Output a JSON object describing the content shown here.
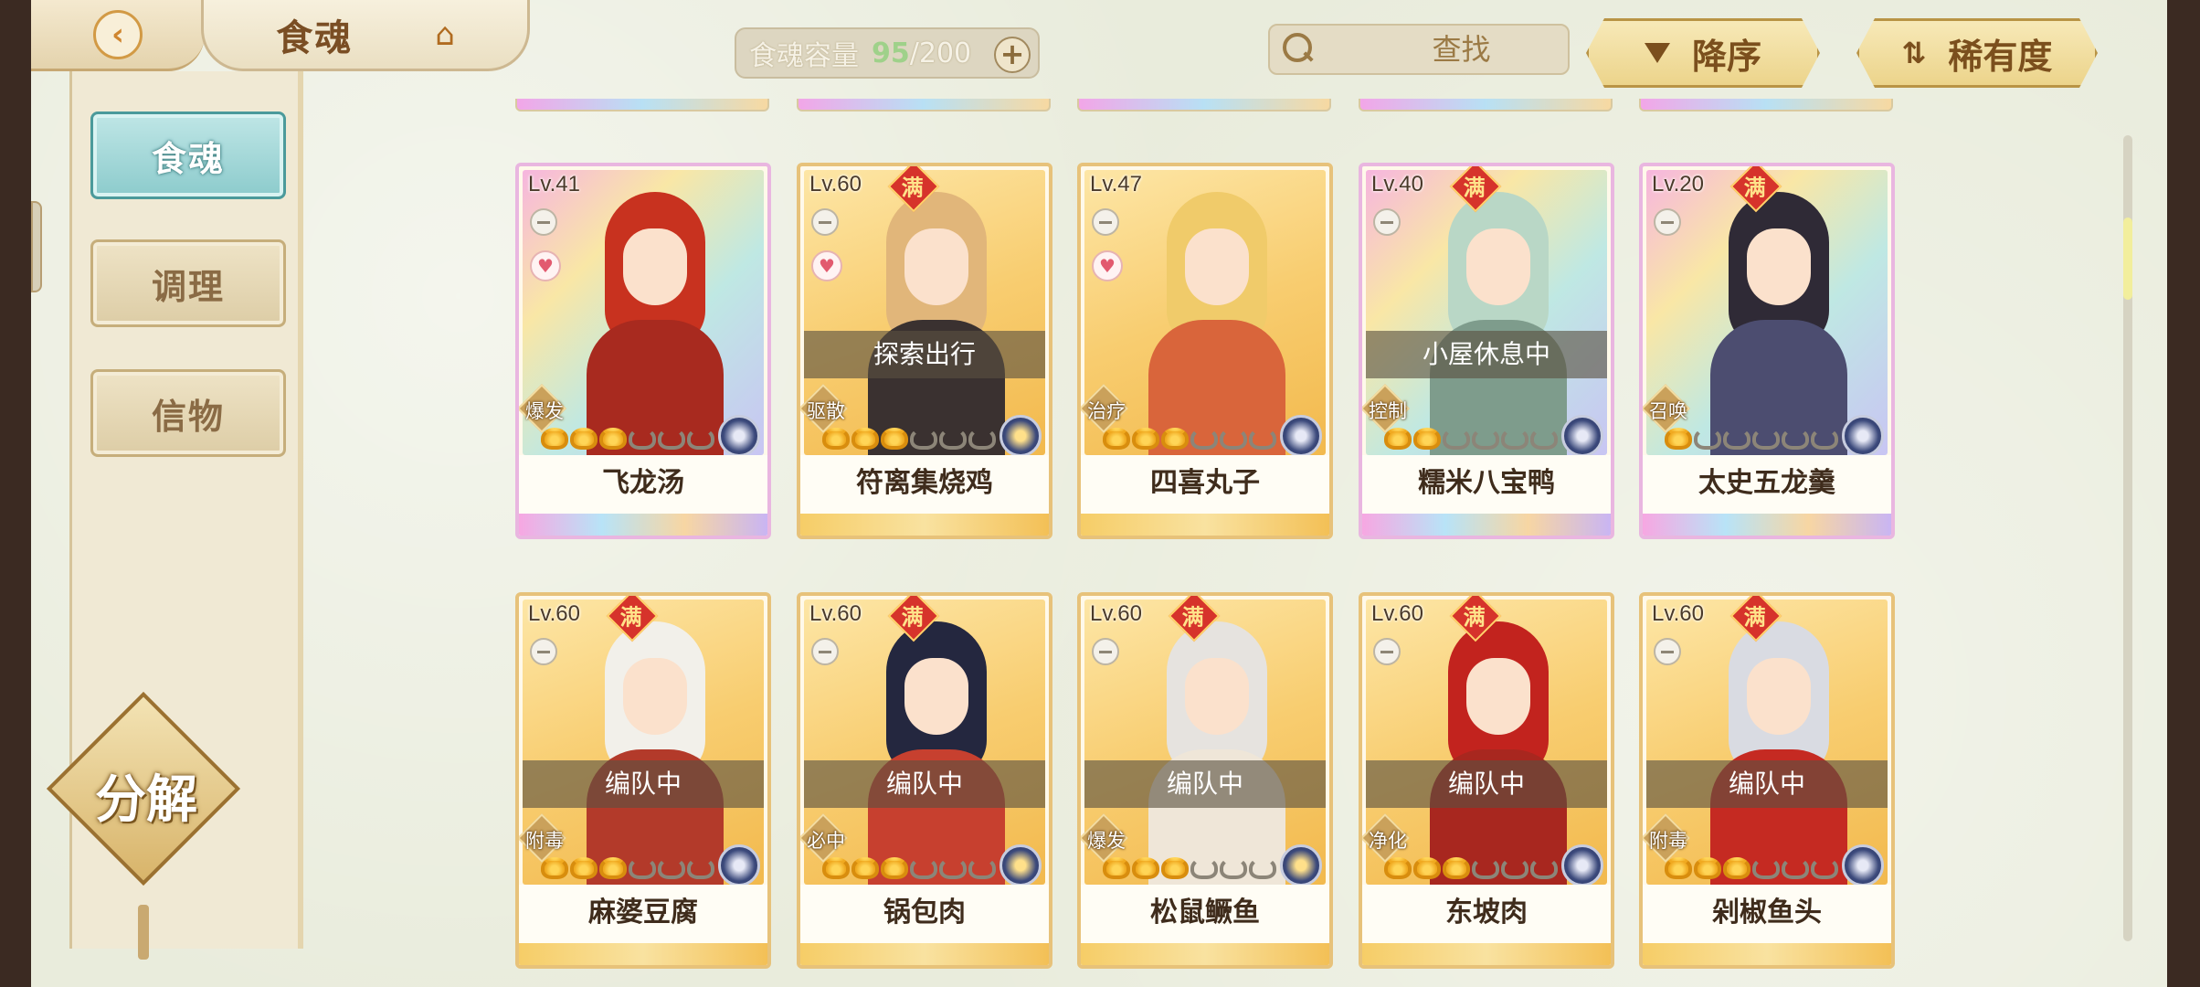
{
  "header": {
    "title": "食魂",
    "capacity_label": "食魂容量",
    "capacity_current": "95",
    "capacity_max": "/200",
    "search_placeholder": "查找",
    "sort_order_label": "降序",
    "sort_key_label": "稀有度"
  },
  "sidebar": {
    "items": [
      {
        "label": "食魂",
        "active": true
      },
      {
        "label": "调理",
        "active": false
      },
      {
        "label": "信物",
        "active": false
      }
    ],
    "decompose_label": "分解"
  },
  "cards": [
    {
      "level": "Lv.41",
      "max": false,
      "heart": true,
      "status": "",
      "role": "爆发",
      "stars_lit": 3,
      "name": "飞龙汤",
      "frame": "rainbow"
    },
    {
      "level": "Lv.60",
      "max": true,
      "max_label": "满",
      "heart": true,
      "status": "探索出行",
      "role": "驱散",
      "stars_lit": 3,
      "name": "符离集烧鸡",
      "frame": "gold"
    },
    {
      "level": "Lv.47",
      "max": false,
      "heart": true,
      "status": "",
      "role": "治疗",
      "stars_lit": 3,
      "name": "四喜丸子",
      "frame": "gold"
    },
    {
      "level": "Lv.40",
      "max": true,
      "max_label": "满",
      "heart": false,
      "status": "小屋休息中",
      "role": "控制",
      "stars_lit": 2,
      "name": "糯米八宝鸭",
      "frame": "rainbow"
    },
    {
      "level": "Lv.20",
      "max": true,
      "max_label": "满",
      "heart": false,
      "status": "",
      "role": "召唤",
      "stars_lit": 1,
      "name": "太史五龙羹",
      "frame": "rainbow"
    },
    {
      "level": "Lv.60",
      "max": true,
      "max_label": "满",
      "heart": false,
      "status": "编队中",
      "role": "附毒",
      "stars_lit": 3,
      "name": "麻婆豆腐",
      "frame": "gold"
    },
    {
      "level": "Lv.60",
      "max": true,
      "max_label": "满",
      "heart": false,
      "status": "编队中",
      "role": "必中",
      "stars_lit": 3,
      "name": "锅包肉",
      "frame": "gold"
    },
    {
      "level": "Lv.60",
      "max": true,
      "max_label": "满",
      "heart": false,
      "status": "编队中",
      "role": "爆发",
      "stars_lit": 3,
      "name": "松鼠鳜鱼",
      "frame": "gold"
    },
    {
      "level": "Lv.60",
      "max": true,
      "max_label": "满",
      "heart": false,
      "status": "编队中",
      "role": "净化",
      "stars_lit": 3,
      "name": "东坡肉",
      "frame": "gold"
    },
    {
      "level": "Lv.60",
      "max": true,
      "max_label": "满",
      "heart": false,
      "status": "编队中",
      "role": "附毒",
      "stars_lit": 3,
      "name": "剁椒鱼头",
      "frame": "gold"
    }
  ],
  "colors": {
    "accent_teal": "#8ccbcc",
    "gold_frame": "#e7c27a",
    "max_badge": "#d6332b"
  }
}
